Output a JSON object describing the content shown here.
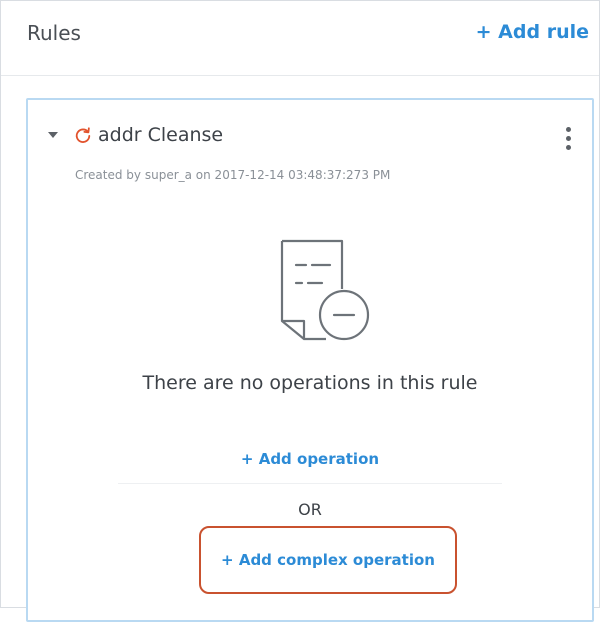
{
  "header": {
    "title": "Rules",
    "add_rule_label": "+ Add rule"
  },
  "rule": {
    "name": "addr Cleanse",
    "created_by": "Created by super_a on 2017-12-14 03:48:37:273 PM",
    "empty_message": "There are no operations in this rule",
    "add_operation_label": "+ Add operation",
    "or_label": "OR",
    "add_complex_label": "+ Add complex operation"
  },
  "icons": {
    "refresh": "refresh-icon",
    "more": "kebab-menu-icon",
    "empty": "document-remove-icon",
    "caret": "caret-down-icon"
  },
  "colors": {
    "accent": "#2c8bd6",
    "refresh": "#e2532d",
    "card_border": "#b9d9f2",
    "highlight_border": "#c9522f",
    "text": "#3d4248",
    "muted": "#8a9097"
  }
}
